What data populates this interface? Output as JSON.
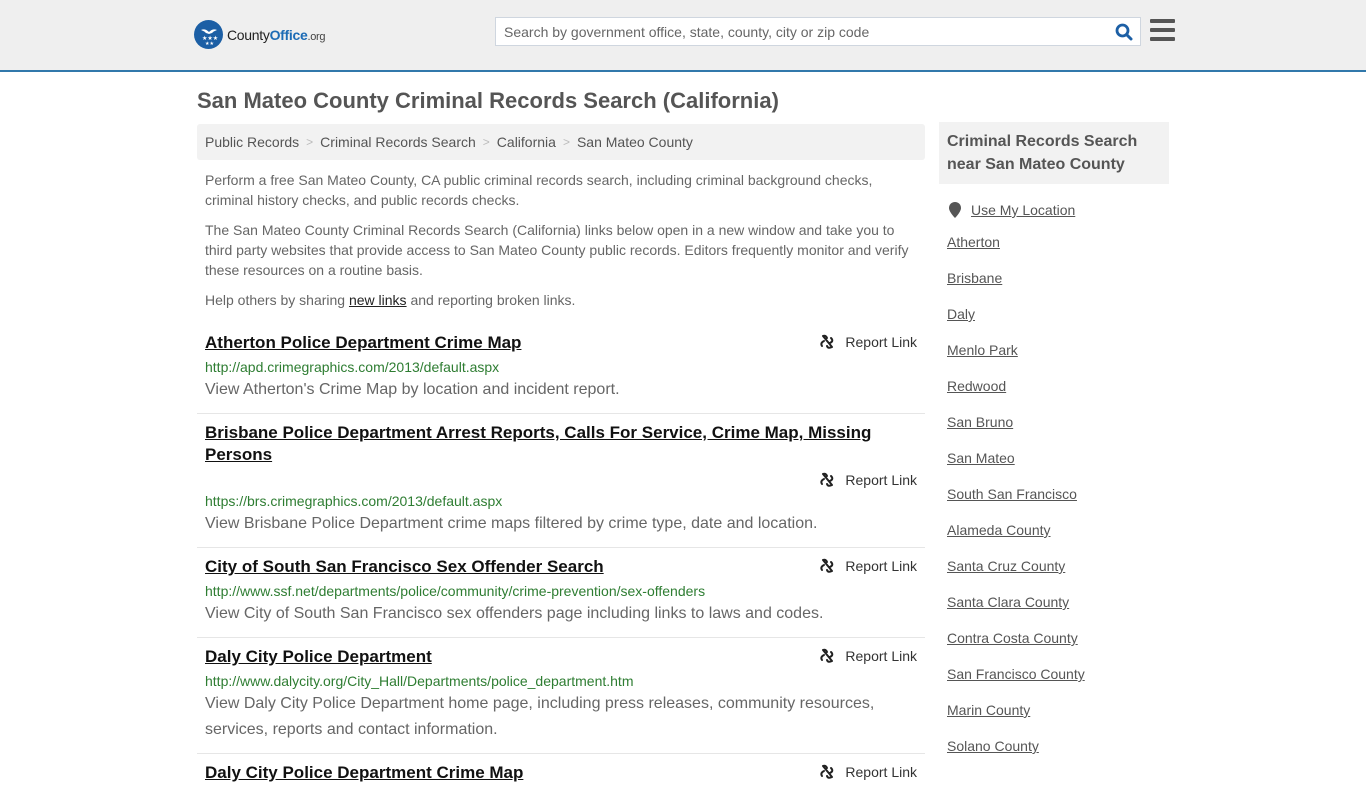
{
  "header": {
    "logo": {
      "text_main": "County",
      "text_accent": "Office",
      "text_suffix": ".org"
    },
    "search": {
      "placeholder": "Search by government office, state, county, city or zip code",
      "value": ""
    },
    "icons": {
      "search": "search-icon",
      "menu": "hamburger-menu-icon"
    }
  },
  "page": {
    "title": "San Mateo County Criminal Records Search (California)"
  },
  "breadcrumb": [
    {
      "label": "Public Records"
    },
    {
      "label": "Criminal Records Search"
    },
    {
      "label": "California"
    },
    {
      "label": "San Mateo County"
    }
  ],
  "intro": {
    "p1": "Perform a free San Mateo County, CA public criminal records search, including criminal background checks, criminal history checks, and public records checks.",
    "p2": "The San Mateo County Criminal Records Search (California) links below open in a new window and take you to third party websites that provide access to San Mateo County public records. Editors frequently monitor and verify these resources on a routine basis.",
    "p3_before": "Help others by sharing ",
    "p3_link": "new links",
    "p3_after": " and reporting broken links."
  },
  "report_label": "Report Link",
  "results": [
    {
      "title": "Atherton Police Department Crime Map",
      "url": "http://apd.crimegraphics.com/2013/default.aspx",
      "description": "View Atherton's Crime Map by location and incident report."
    },
    {
      "title": "Brisbane Police Department Arrest Reports, Calls For Service, Crime Map, Missing Persons",
      "url": "https://brs.crimegraphics.com/2013/default.aspx",
      "description": "View Brisbane Police Department crime maps filtered by crime type, date and location."
    },
    {
      "title": "City of South San Francisco Sex Offender Search",
      "url": "http://www.ssf.net/departments/police/community/crime-prevention/sex-offenders",
      "description": "View City of South San Francisco sex offenders page including links to laws and codes."
    },
    {
      "title": "Daly City Police Department",
      "url": "http://www.dalycity.org/City_Hall/Departments/police_department.htm",
      "description": "View Daly City Police Department home page, including press releases, community resources, services, reports and contact information."
    },
    {
      "title": "Daly City Police Department Crime Map",
      "url": "",
      "description": ""
    }
  ],
  "aside": {
    "title": "Criminal Records Search near San Mateo County",
    "use_location": "Use My Location",
    "links": [
      "Atherton",
      "Brisbane",
      "Daly",
      "Menlo Park",
      "Redwood",
      "San Bruno",
      "San Mateo",
      "South San Francisco",
      "Alameda County",
      "Santa Cruz County",
      "Santa Clara County",
      "Contra Costa County",
      "San Francisco County",
      "Marin County",
      "Solano County"
    ]
  },
  "colors": {
    "header_bg": "#efefef",
    "header_border": "#3178ab",
    "brand_blue": "#1c5fa5",
    "url_green": "#2e7d32"
  }
}
